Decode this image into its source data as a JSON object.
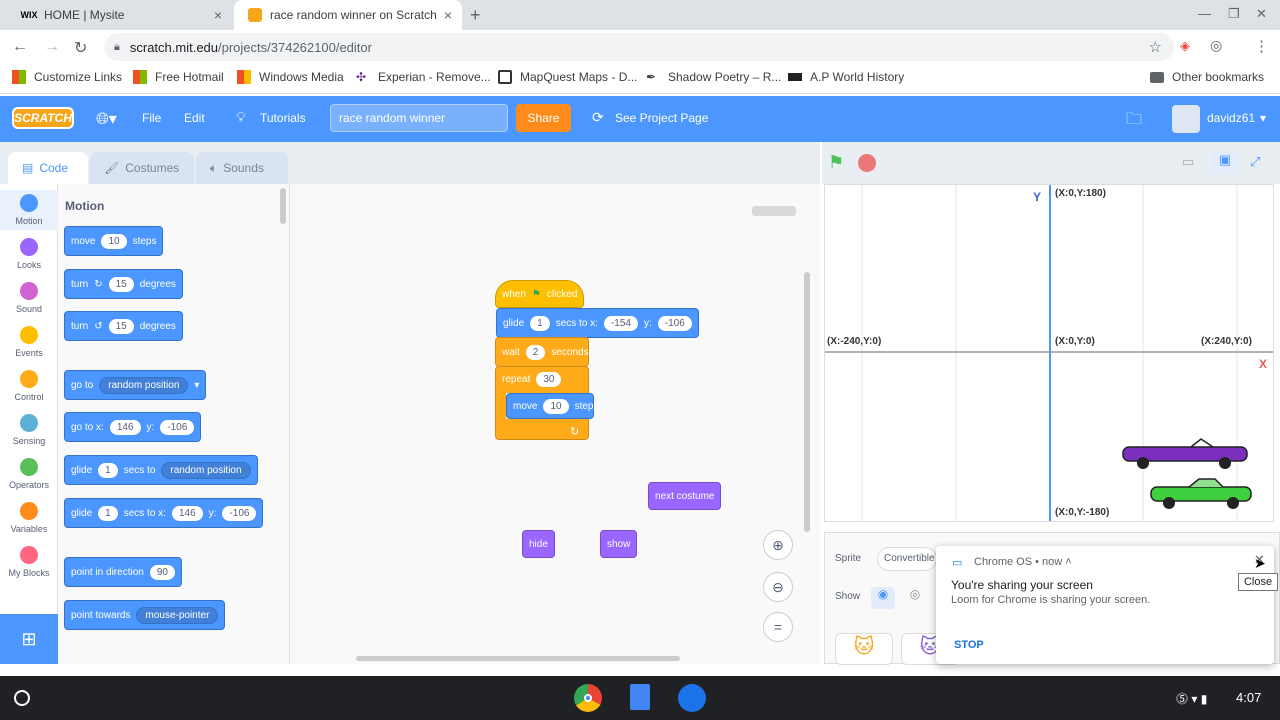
{
  "tabs": [
    {
      "label": "HOME | Mysite",
      "favicon": "WIX"
    },
    {
      "label": "race random winner on Scratch",
      "favicon": "scratch-icon"
    }
  ],
  "url": {
    "domain": "scratch.mit.edu",
    "path": "/projects/374262100/editor"
  },
  "bookmarks": [
    "Customize Links",
    "Free Hotmail",
    "Windows Media",
    "Experian - Remove...",
    "MapQuest Maps - D...",
    "Shadow Poetry – R...",
    "A.P World History",
    "Other bookmarks"
  ],
  "menubar": {
    "logo": "SCRATCH",
    "file": "File",
    "edit": "Edit",
    "tutorials": "Tutorials",
    "project_title": "race random winner",
    "share": "Share",
    "see_project": "See Project Page",
    "username": "davidz61"
  },
  "editor_tabs": {
    "code": "Code",
    "costumes": "Costumes",
    "sounds": "Sounds"
  },
  "categories": [
    {
      "label": "Motion",
      "color": "#4c97ff"
    },
    {
      "label": "Looks",
      "color": "#9966ff"
    },
    {
      "label": "Sound",
      "color": "#cf63cf"
    },
    {
      "label": "Events",
      "color": "#ffbf00"
    },
    {
      "label": "Control",
      "color": "#ffab19"
    },
    {
      "label": "Sensing",
      "color": "#5cb1d6"
    },
    {
      "label": "Operators",
      "color": "#59c059"
    },
    {
      "label": "Variables",
      "color": "#ff8c1a"
    },
    {
      "label": "My Blocks",
      "color": "#ff6680"
    }
  ],
  "palette": {
    "heading": "Motion",
    "move": {
      "a": "move",
      "n": "10",
      "b": "steps"
    },
    "turn_r": {
      "a": "turn",
      "n": "15",
      "b": "degrees"
    },
    "turn_l": {
      "a": "turn",
      "n": "15",
      "b": "degrees"
    },
    "goto": {
      "a": "go to",
      "dd": "random position"
    },
    "gotoxy": {
      "a": "go to x:",
      "x": "146",
      "b": "y:",
      "y": "-106"
    },
    "glide_rand": {
      "a": "glide",
      "n": "1",
      "b": "secs to",
      "dd": "random position"
    },
    "glide_xy": {
      "a": "glide",
      "n": "1",
      "b": "secs to x:",
      "x": "146",
      "c": "y:",
      "y": "-106"
    },
    "point_dir": {
      "a": "point in direction",
      "n": "90"
    },
    "point_towards": {
      "a": "point towards",
      "dd": "mouse-pointer"
    }
  },
  "script": {
    "hat": {
      "a": "when",
      "b": "clicked"
    },
    "glide": {
      "a": "glide",
      "n": "1",
      "b": "secs to x:",
      "x": "-154",
      "c": "y:",
      "y": "-106"
    },
    "wait": {
      "a": "wait",
      "n": "2",
      "b": "seconds"
    },
    "repeat": {
      "a": "repeat",
      "n": "30"
    },
    "move": {
      "a": "move",
      "n": "10",
      "b": "steps"
    },
    "next_costume": "next costume",
    "hide": "hide",
    "show": "show"
  },
  "stage": {
    "top": "(X:0,Y:180)",
    "bottom": "(X:0,Y:-180)",
    "left": "(X:-240,Y:0)",
    "right": "(X:240,Y:0)",
    "center": "(X:0,Y:0)",
    "y_axis": "Y",
    "x_axis": "X"
  },
  "sprite_pane": {
    "sprite_label": "Sprite",
    "sprite_name": "Convertible",
    "show": "Show"
  },
  "notification": {
    "app": "Chrome OS",
    "time": "now",
    "title": "You're sharing your screen",
    "body": "Loom for Chrome is sharing your screen.",
    "stop": "STOP",
    "tooltip": "Close"
  },
  "clock": "4:07"
}
